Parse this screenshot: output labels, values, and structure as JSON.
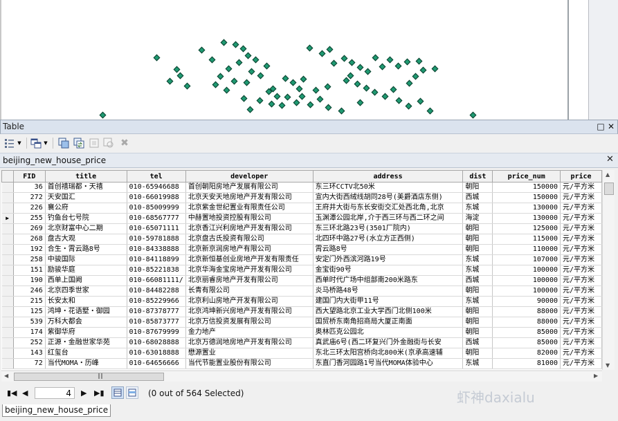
{
  "window": {
    "title": "Table"
  },
  "tab": {
    "name": "beijing_new_house_price"
  },
  "columns": [
    "FID",
    "title",
    "tel",
    "developer",
    "address",
    "dist",
    "price_num",
    "price"
  ],
  "rows": [
    {
      "fid": "36",
      "title": "首创禧瑞都・天禧",
      "tel": "010-65946688",
      "developer": "首创朝阳房地产发展有限公司",
      "address": "东三环CCTV北50米",
      "dist": "朝阳",
      "price_num": "150000",
      "price": "元/平方米"
    },
    {
      "fid": "272",
      "title": "天安国汇",
      "tel": "010-66019988",
      "developer": "北京天安天地房地产开发有限公司",
      "address": "宣内大街西绒线胡同28号(美爵酒店东侧)",
      "dist": "西城",
      "price_num": "150000",
      "price": "元/平方米"
    },
    {
      "fid": "226",
      "title": "襄公府",
      "tel": "010-85009999",
      "developer": "北京紫金世纪置业有限责任公司",
      "address": "王府井大街与东长安街交汇处西北角,北京",
      "dist": "东城",
      "price_num": "130000",
      "price": "元/平方米"
    },
    {
      "fid": "255",
      "title": "钓鱼台七号院",
      "tel": "010-68567777",
      "developer": "中赫置地投资控股有限公司",
      "address": "玉渊潭公园北岸,介于西三环与西二环之间",
      "dist": "海淀",
      "price_num": "130000",
      "price": "元/平方米"
    },
    {
      "fid": "269",
      "title": "北京财富中心二期",
      "tel": "010-65071111",
      "developer": "北京香江兴利房地产开发有限公司",
      "address": "东三环北路23号(3501厂院内)",
      "dist": "朝阳",
      "price_num": "125000",
      "price": "元/平方米"
    },
    {
      "fid": "268",
      "title": "盘古大观",
      "tel": "010-59781888",
      "developer": "北京盘古氏投资有限公司",
      "address": "北四环中路27号(水立方正西侧)",
      "dist": "朝阳",
      "price_num": "115000",
      "price": "元/平方米"
    },
    {
      "fid": "192",
      "title": "合生・霄云路8号",
      "tel": "010-84338888",
      "developer": "北京新京润房地产有限公司",
      "address": "霄云路8号",
      "dist": "朝阳",
      "price_num": "110000",
      "price": "元/平方米"
    },
    {
      "fid": "258",
      "title": "中骏国际",
      "tel": "010-84118899",
      "developer": "北京新恒基创业房地产开发有限责任",
      "address": "安定门外西滨河路19号",
      "dist": "东城",
      "price_num": "107000",
      "price": "元/平方米"
    },
    {
      "fid": "151",
      "title": "励骏华庭",
      "tel": "010-85221838",
      "developer": "北京华海金宝房地产开发有限公司",
      "address": "金宝街90号",
      "dist": "东城",
      "price_num": "100000",
      "price": "元/平方米"
    },
    {
      "fid": "190",
      "title": "西单上国阙",
      "tel": "010-66081111/",
      "developer": "北京丽睿房地产开发有限公司",
      "address": "西单时代广场中组部南200米路东",
      "dist": "西城",
      "price_num": "100000",
      "price": "元/平方米"
    },
    {
      "fid": "246",
      "title": "北京四季世家",
      "tel": "010-84482288",
      "developer": "长青有限公司",
      "address": "炎马桥路48号",
      "dist": "朝阳",
      "price_num": "100000",
      "price": "元/平方米"
    },
    {
      "fid": "215",
      "title": "长安太和",
      "tel": "010-85229966",
      "developer": "北京利山房地产开发有限公司",
      "address": "建国门内大街甲11号",
      "dist": "东城",
      "price_num": "90000",
      "price": "元/平方米"
    },
    {
      "fid": "125",
      "title": "鸿坤・花语墅・御园",
      "tel": "010-87378777",
      "developer": "北京鸿坤新兴房地产开发有限公司",
      "address": "西大望路北京工业大学西门北侧100米",
      "dist": "朝阳",
      "price_num": "88000",
      "price": "元/平方米"
    },
    {
      "fid": "539",
      "title": "万科大都会",
      "tel": "010-85873777",
      "developer": "北京万信投资发展有限公司",
      "address": "国贸桥东南角招商局大厦正南面",
      "dist": "朝阳",
      "price_num": "88000",
      "price": "元/平方米"
    },
    {
      "fid": "174",
      "title": "紫御华府",
      "tel": "010-87679999",
      "developer": "金力地产",
      "address": "奥林匹克公园北",
      "dist": "朝阳",
      "price_num": "85000",
      "price": "元/平方米"
    },
    {
      "fid": "252",
      "title": "正源・金融世家华苑",
      "tel": "010-68028888",
      "developer": "北京万德润地房地产开发有限公司",
      "address": "真武庙6号(西二环复兴门外金融街与长安",
      "dist": "西城",
      "price_num": "85000",
      "price": "元/平方米"
    },
    {
      "fid": "143",
      "title": "红玺台",
      "tel": "010-63018888",
      "developer": "懋源置业",
      "address": "东北三环太阳宫桥向北800米(京承高速辅",
      "dist": "朝阳",
      "price_num": "82000",
      "price": "元/平方米"
    },
    {
      "fid": "72",
      "title": "当代MOMA・历峰",
      "tel": "010-64656666",
      "developer": "当代节能置业股份有限公司",
      "address": "东直门香河园路1号当代MOMA体验中心",
      "dist": "东城",
      "price_num": "81000",
      "price": "元/平方米"
    }
  ],
  "selected_row_index": 3,
  "status": {
    "page": "4",
    "selection": "(0 out of 564 Selected)"
  },
  "watermark": "虾神daxialu",
  "bottom_tab": {
    "label": "beijing_new_house_price"
  },
  "colors": {
    "point_fill": "#1f9a72",
    "header_bg": "#f1f1f1",
    "titlebar_bg": "#dbe3ee"
  }
}
